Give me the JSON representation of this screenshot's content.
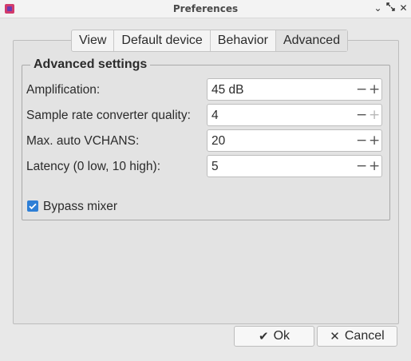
{
  "window": {
    "title": "Preferences",
    "minimize_icon": "minimize-icon",
    "maximize_icon": "maximize-icon",
    "close_icon": "close-icon"
  },
  "tabs": [
    {
      "label": "View",
      "active": false
    },
    {
      "label": "Default device",
      "active": false
    },
    {
      "label": "Behavior",
      "active": false
    },
    {
      "label": "Advanced",
      "active": true
    }
  ],
  "group": {
    "title": "Advanced settings",
    "rows": [
      {
        "label": "Amplification:",
        "value": "45 dB",
        "plus_enabled": true
      },
      {
        "label": "Sample rate converter quality:",
        "value": "4",
        "plus_enabled": false
      },
      {
        "label": "Max. auto VCHANS:",
        "value": "20",
        "plus_enabled": true
      },
      {
        "label": "Latency (0 low, 10 high):",
        "value": "5",
        "plus_enabled": true
      }
    ],
    "bypass_mixer": {
      "label": "Bypass mixer",
      "checked": true
    }
  },
  "buttons": {
    "ok": {
      "label": "Ok",
      "icon": "checkmark-icon"
    },
    "cancel": {
      "label": "Cancel",
      "icon": "x-icon"
    }
  },
  "colors": {
    "accent": "#2e7fd6",
    "app_icon": "#d23b6b"
  }
}
